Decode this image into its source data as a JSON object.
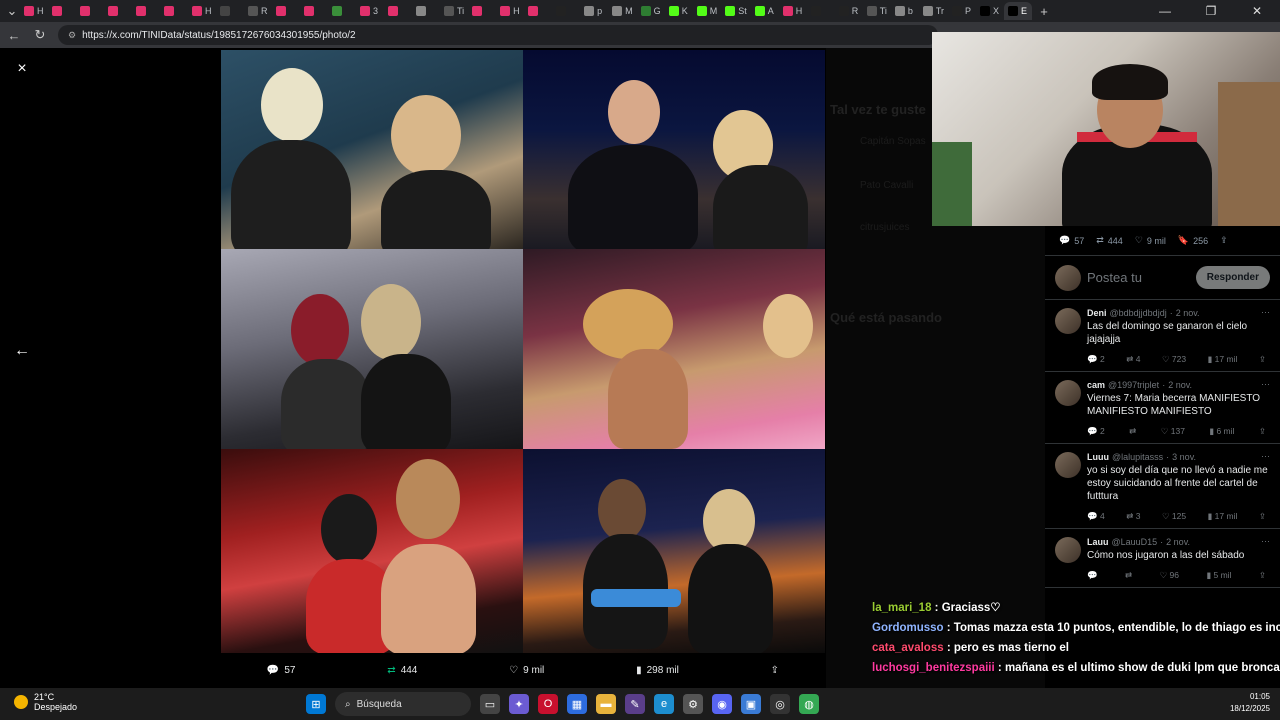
{
  "browser": {
    "tabs": [
      {
        "label": "H",
        "color": "#e1306c"
      },
      {
        "label": "",
        "color": "#e1306c"
      },
      {
        "label": "",
        "color": "#e1306c"
      },
      {
        "label": "",
        "color": "#e1306c"
      },
      {
        "label": "",
        "color": "#e1306c"
      },
      {
        "label": "",
        "color": "#e1306c"
      },
      {
        "label": "H",
        "color": "#e1306c"
      },
      {
        "label": "",
        "color": "#444"
      },
      {
        "label": "R",
        "color": "#555"
      },
      {
        "label": "",
        "color": "#e1306c"
      },
      {
        "label": "",
        "color": "#e1306c"
      },
      {
        "label": "",
        "color": "#3a8f3a"
      },
      {
        "label": "3",
        "color": "#e1306c"
      },
      {
        "label": "",
        "color": "#e1306c"
      },
      {
        "label": "",
        "color": "#888"
      },
      {
        "label": "Ti",
        "color": "#555"
      },
      {
        "label": "",
        "color": "#e1306c"
      },
      {
        "label": "H",
        "color": "#e1306c"
      },
      {
        "label": "",
        "color": "#e1306c"
      },
      {
        "label": "",
        "color": "#222"
      },
      {
        "label": "p",
        "color": "#888"
      },
      {
        "label": "M",
        "color": "#888"
      },
      {
        "label": "G",
        "color": "#2e7d32"
      },
      {
        "label": "K",
        "color": "#53fc18"
      },
      {
        "label": "M",
        "color": "#53fc18"
      },
      {
        "label": "St",
        "color": "#53fc18"
      },
      {
        "label": "A",
        "color": "#53fc18"
      },
      {
        "label": "H",
        "color": "#e1306c"
      },
      {
        "label": "",
        "color": "#222"
      },
      {
        "label": "R",
        "color": "#222"
      },
      {
        "label": "Ti",
        "color": "#555"
      },
      {
        "label": "b",
        "color": "#888"
      },
      {
        "label": "Tr",
        "color": "#888"
      },
      {
        "label": "P",
        "color": "#222"
      },
      {
        "label": "X",
        "color": "#000"
      },
      {
        "label": "E",
        "color": "#000"
      }
    ],
    "active_tab_label": "E",
    "url": "https://x.com/TINIData/status/1985172676034301955/photo/2",
    "window_controls": [
      "—",
      "❐",
      "✕"
    ]
  },
  "viewer": {
    "close_icon": "×",
    "prev_icon": "←",
    "stats": {
      "replies": "57",
      "reposts": "444",
      "likes": "9 mil",
      "views": "298 mil"
    }
  },
  "background_page": {
    "you_might_like": "Tal vez te guste",
    "whats_happening": "Qué está pasando",
    "names": [
      "Capitán Sopas",
      "Pato Cavalli",
      "citrusjuices"
    ]
  },
  "side_panel": {
    "post_stats": {
      "replies": "57",
      "reposts": "444",
      "likes": "9 mil",
      "bookmarks": "256"
    },
    "reply_placeholder": "Postea tu",
    "reply_button": "Responder",
    "comments": [
      {
        "name": "Deni",
        "handle": "@bdbdjjdbdjdj",
        "date": "2 nov.",
        "text": "Las del domingo se ganaron el cielo jajajajja",
        "replies": "2",
        "reposts": "4",
        "likes": "723",
        "views": "17 mil"
      },
      {
        "name": "cam",
        "handle": "@1997triplet",
        "date": "2 nov.",
        "text": "Viernes 7: Maria becerra MANIFIESTO MANIFIESTO MANIFIESTO",
        "replies": "2",
        "reposts": "",
        "likes": "137",
        "views": "6 mil"
      },
      {
        "name": "Luuu",
        "handle": "@lalupitasss",
        "date": "3 nov.",
        "text": "yo si soy del día que no llevó a nadie me estoy suicidando al frente del cartel de futttura",
        "replies": "4",
        "reposts": "3",
        "likes": "125",
        "views": "17 mil"
      },
      {
        "name": "Lauu",
        "handle": "@LauuD15",
        "date": "2 nov.",
        "text": "Cómo nos jugaron a las del sábado",
        "replies": "",
        "reposts": "",
        "likes": "96",
        "views": "5 mil"
      }
    ]
  },
  "chat": [
    {
      "user": "la_mari_18",
      "msg": "Graciass♡",
      "color": "#9acd32"
    },
    {
      "user": "Gordomusso",
      "msg": "Tomas mazza esta 10 puntos, entendible, lo de thiago es increible",
      "color": "#8fb4ff"
    },
    {
      "user": "cata_avaloss",
      "msg": "pero es mas tierno el",
      "color": "#ff4b6e"
    },
    {
      "user": "luchosgi_benitezspaiii",
      "msg": "mañana es el ultimo show de duki lpm que bronca es no tener plata",
      "color": "#ff3aa0"
    }
  ],
  "taskbar": {
    "temperature": "21°C",
    "condition": "Despejado",
    "search_label": "Búsqueda",
    "time": "01:05",
    "date": "18/12/2025"
  }
}
